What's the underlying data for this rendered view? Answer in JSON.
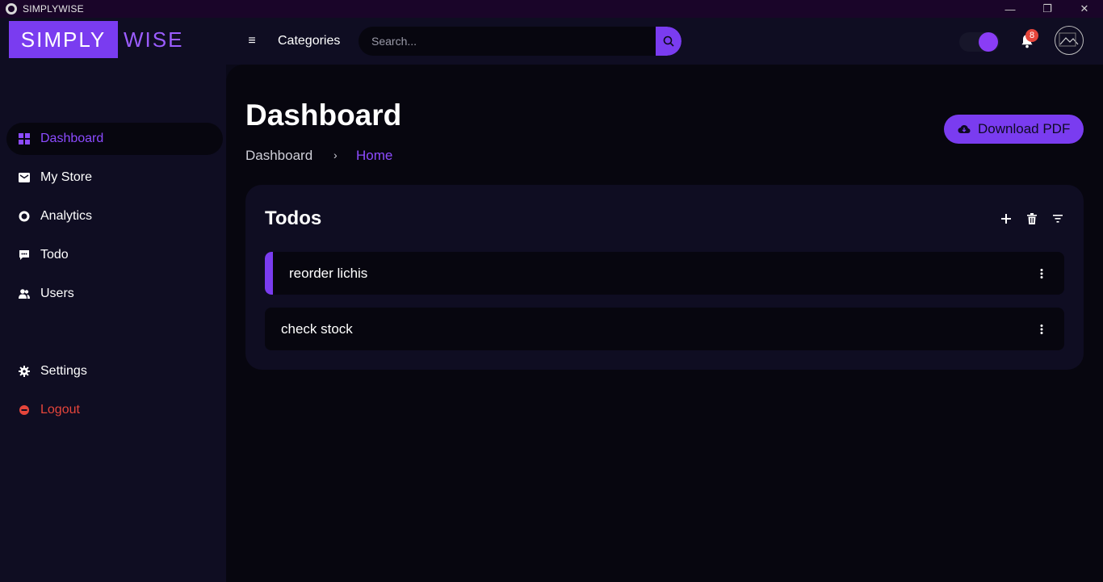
{
  "window": {
    "title": "SIMPLYWISE",
    "minimize_glyph": "—",
    "restore_glyph": "❐",
    "close_glyph": "✕"
  },
  "header": {
    "logo_part1": "SIMPLY",
    "logo_part2": "WISE",
    "menu_glyph": "≡",
    "categories_label": "Categories",
    "search_placeholder": "Search...",
    "notification_count": "8",
    "theme_toggle_on": true
  },
  "sidebar": {
    "items": [
      {
        "label": "Dashboard",
        "icon": "grid-icon",
        "active": true
      },
      {
        "label": "My Store",
        "icon": "store-icon"
      },
      {
        "label": "Analytics",
        "icon": "donut-chart-icon"
      },
      {
        "label": "Todo",
        "icon": "chat-icon"
      },
      {
        "label": "Users",
        "icon": "users-icon"
      },
      {
        "label": "Settings",
        "icon": "gear-icon"
      },
      {
        "label": "Logout",
        "icon": "logout-icon"
      }
    ]
  },
  "main": {
    "title": "Dashboard",
    "breadcrumb": [
      "Dashboard",
      "Home"
    ],
    "breadcrumb_separator": "›",
    "download_label": "Download PDF",
    "card": {
      "title": "Todos",
      "todos": [
        {
          "text": "reorder lichis",
          "highlighted": true
        },
        {
          "text": "check stock",
          "highlighted": false
        }
      ]
    }
  },
  "colors": {
    "accent": "#7a3cf0",
    "active_text": "#8c4bff",
    "logout": "#e5453b",
    "background": "#07060f",
    "panel": "#0f0d22"
  }
}
